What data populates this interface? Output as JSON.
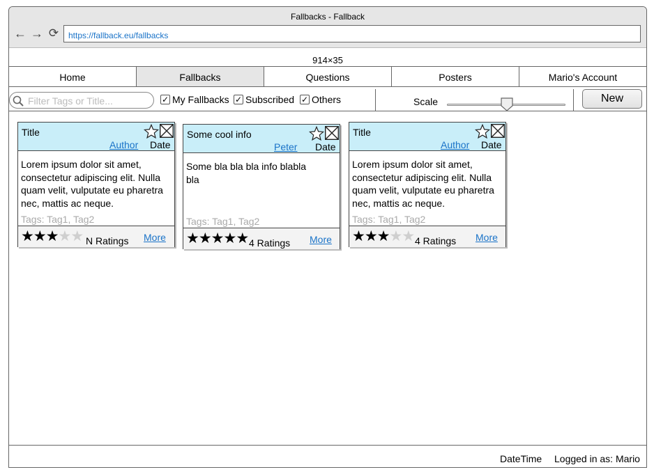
{
  "window": {
    "title": "Fallbacks - Fallback",
    "url": "https://fallback.eu/fallbacks"
  },
  "size_label": "914×35",
  "tabs": [
    {
      "label": "Home"
    },
    {
      "label": "Fallbacks"
    },
    {
      "label": "Questions"
    },
    {
      "label": "Posters"
    },
    {
      "label": "Mario's Account"
    }
  ],
  "toolbar": {
    "search_placeholder": "Filter Tags or Title...",
    "filters": [
      {
        "label": "My Fallbacks",
        "checked": true
      },
      {
        "label": "Subscribed",
        "checked": true
      },
      {
        "label": "Others",
        "checked": true
      }
    ],
    "scale_label": "Scale",
    "scale_value": 0.5,
    "new_label": "New"
  },
  "cards": [
    {
      "title": "Title",
      "author": "Author",
      "date": "Date",
      "body": "Lorem ipsum dolor sit amet, consectetur adipiscing elit. Nulla quam velit, vulputate eu pharetra nec, mattis ac neque.",
      "tags": "Tags: Tag1, Tag2",
      "stars": 3,
      "ratings": "N Ratings",
      "more": "More"
    },
    {
      "title": "Some cool info",
      "author": "Peter",
      "date": "Date",
      "body": "Some bla bla bla info blabla bla",
      "tags": "Tags: Tag1, Tag2",
      "stars": 5,
      "ratings": "4 Ratings",
      "more": "More"
    },
    {
      "title": "Title",
      "author": "Author",
      "date": "Date",
      "body": "Lorem ipsum dolor sit amet, consectetur adipiscing elit. Nulla quam velit, vulputate eu pharetra nec, mattis ac neque.",
      "tags": "Tags: Tag1, Tag2",
      "stars": 3,
      "ratings": "4 Ratings",
      "more": "More"
    }
  ],
  "statusbar": {
    "datetime": "DateTime",
    "user": "Logged in as: Mario"
  }
}
